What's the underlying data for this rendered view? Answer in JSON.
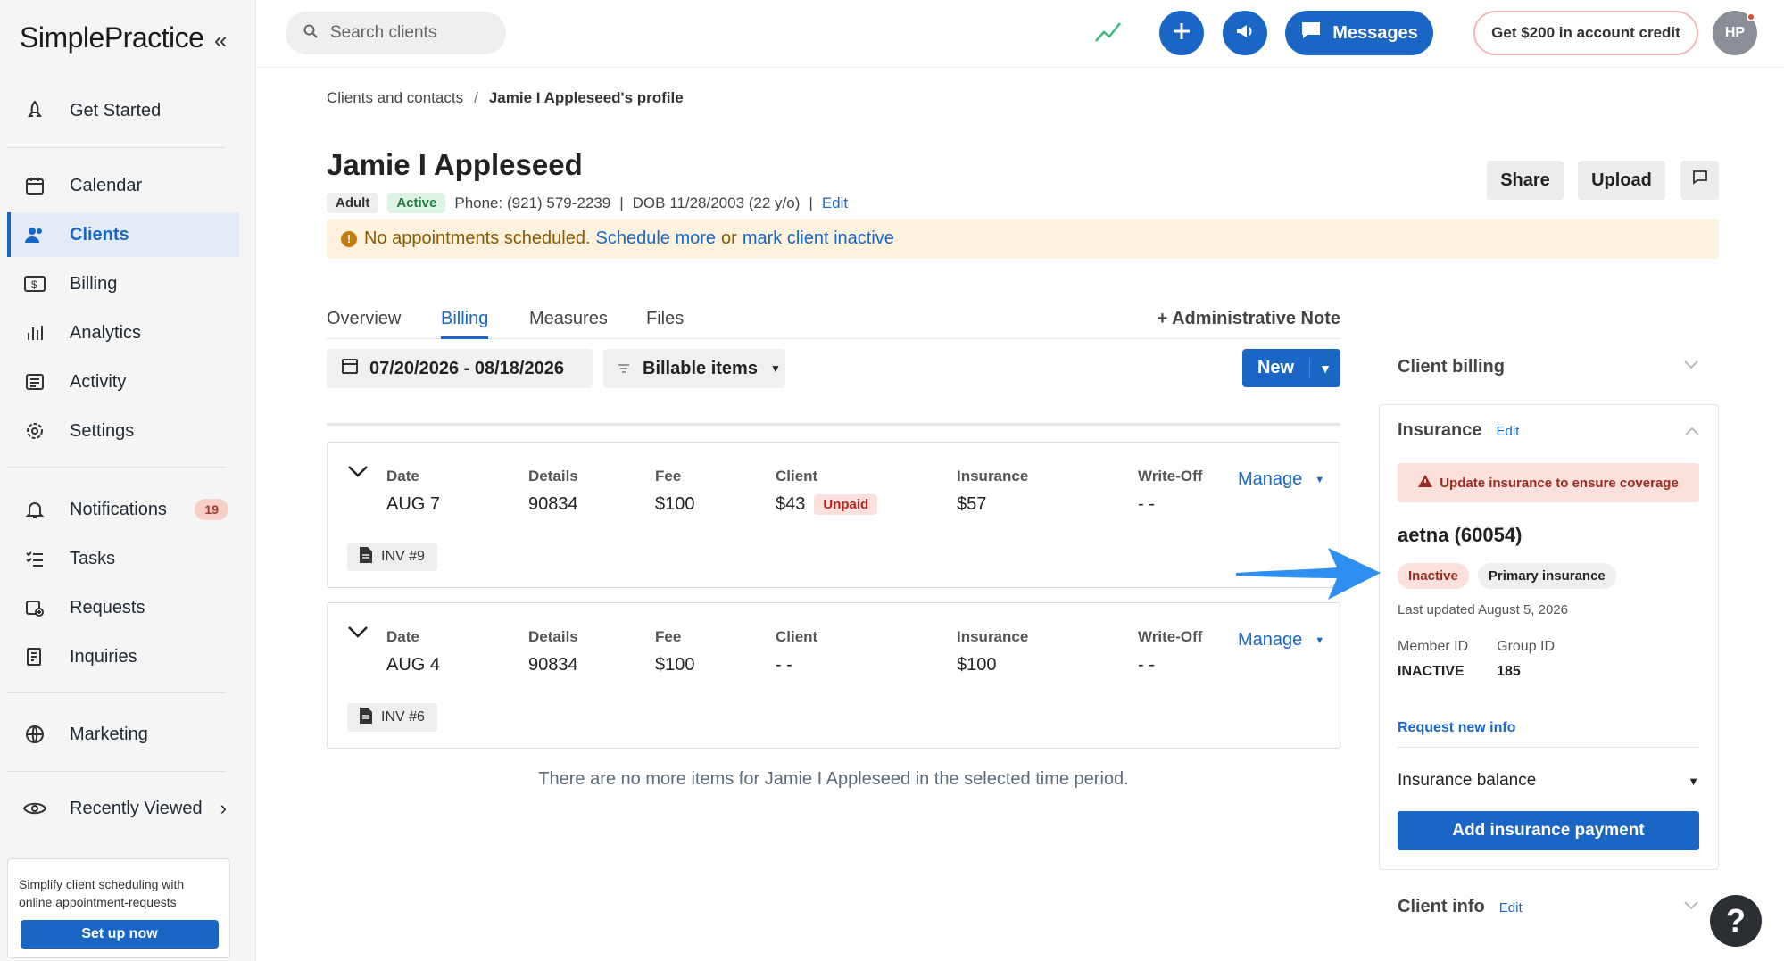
{
  "app": {
    "logo": "SimplePractice"
  },
  "sidebar": {
    "items": [
      {
        "label": "Get Started",
        "icon": "rocket-icon"
      },
      {
        "label": "Calendar",
        "icon": "calendar-icon"
      },
      {
        "label": "Clients",
        "icon": "users-icon"
      },
      {
        "label": "Billing",
        "icon": "dollar-icon"
      },
      {
        "label": "Analytics",
        "icon": "bar-chart-icon"
      },
      {
        "label": "Activity",
        "icon": "list-icon"
      },
      {
        "label": "Settings",
        "icon": "gear-icon"
      },
      {
        "label": "Notifications",
        "icon": "bell-icon",
        "badge": "19"
      },
      {
        "label": "Tasks",
        "icon": "checklist-icon"
      },
      {
        "label": "Requests",
        "icon": "calendar-plus-icon"
      },
      {
        "label": "Inquiries",
        "icon": "inquiry-icon"
      },
      {
        "label": "Marketing",
        "icon": "globe-icon"
      },
      {
        "label": "Recently Viewed",
        "icon": "eye-icon"
      }
    ],
    "promo": {
      "text": "Simplify client scheduling with online appointment-requests",
      "button": "Set up now"
    }
  },
  "topbar": {
    "search_placeholder": "Search clients",
    "messages_label": "Messages",
    "credit_label": "Get $200 in account credit",
    "avatar_initials": "HP"
  },
  "breadcrumb": {
    "parent": "Clients and contacts",
    "current": "Jamie I Appleseed's profile"
  },
  "client": {
    "name": "Jamie I Appleseed",
    "type_badge": "Adult",
    "status_badge": "Active",
    "phone": "Phone: (921) 579-2239",
    "dob": "DOB 11/28/2003 (22 y/o)",
    "edit": "Edit"
  },
  "actions": {
    "share": "Share",
    "upload": "Upload"
  },
  "alert": {
    "text": "No appointments scheduled.",
    "link1": "Schedule more",
    "or": "or",
    "link2": "mark client inactive"
  },
  "tabs": [
    "Overview",
    "Billing",
    "Measures",
    "Files"
  ],
  "admin_note": "+ Administrative Note",
  "filters": {
    "date_range": "07/20/2026 - 08/18/2026",
    "billable": "Billable items",
    "new": "New"
  },
  "billing_items": {
    "headers": [
      "Date",
      "Details",
      "Fee",
      "Client",
      "Insurance",
      "Write-Off"
    ],
    "manage": "Manage",
    "rows": [
      {
        "date": "AUG 7",
        "details": "90834",
        "fee": "$100",
        "client": "$43",
        "client_badge": "Unpaid",
        "insurance": "$57",
        "writeoff": "- -",
        "invoice": "INV #9"
      },
      {
        "date": "AUG 4",
        "details": "90834",
        "fee": "$100",
        "client": "- -",
        "client_badge": "",
        "insurance": "$100",
        "writeoff": "- -",
        "invoice": "INV #6"
      }
    ],
    "empty_message": "There are no more items for Jamie I Appleseed in the selected time period."
  },
  "right_panel": {
    "client_billing": "Client billing",
    "insurance": {
      "title": "Insurance",
      "edit": "Edit",
      "warning": "Update insurance to ensure coverage",
      "payer": "aetna (60054)",
      "status": "Inactive",
      "type": "Primary insurance",
      "updated": "Last updated August 5, 2026",
      "member_id_label": "Member ID",
      "member_id": "INACTIVE",
      "group_id_label": "Group ID",
      "group_id": "185",
      "request_link": "Request new info",
      "balance_label": "Insurance balance",
      "add_payment": "Add insurance payment"
    },
    "client_info": "Client info",
    "client_info_edit": "Edit"
  },
  "colors": {
    "accent": "#1a66c5",
    "arrow": "#2f8ff0"
  }
}
